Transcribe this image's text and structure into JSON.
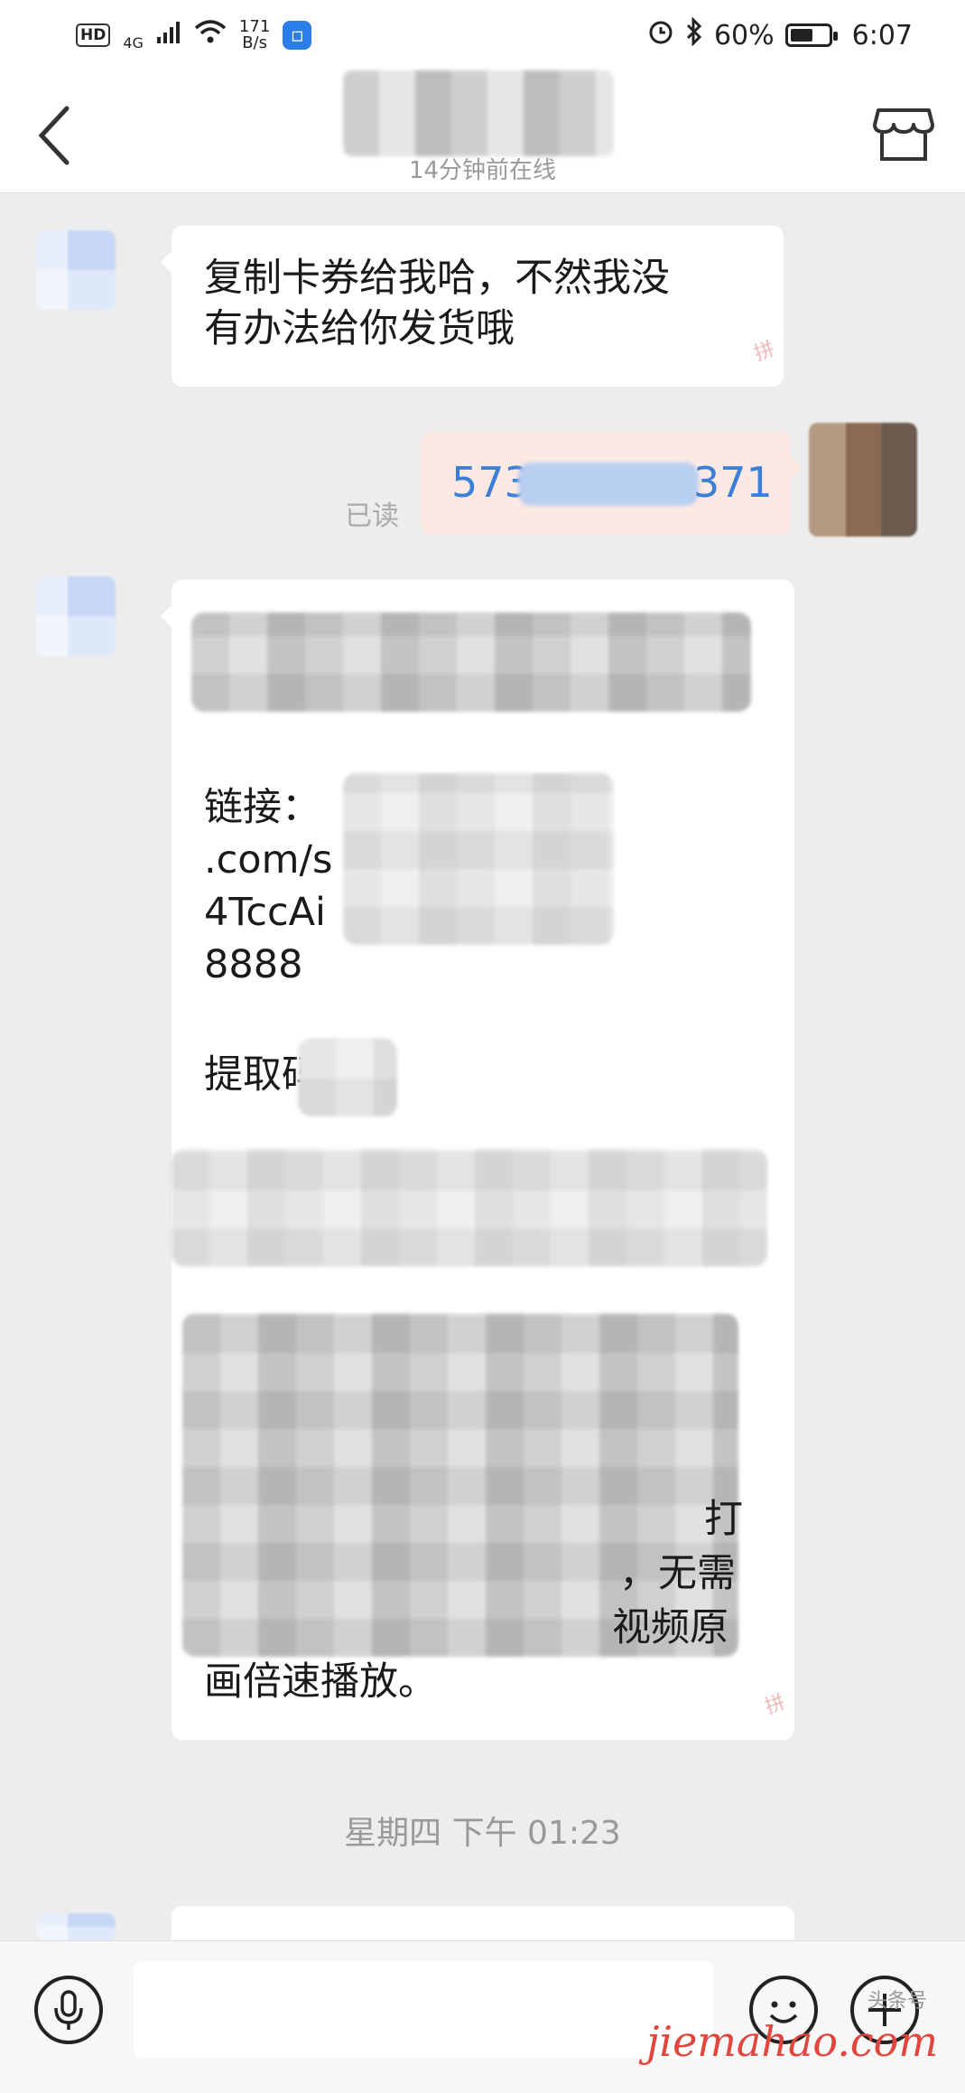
{
  "status_bar": {
    "hd": "HD",
    "network": "4G",
    "speed_value": "171",
    "speed_unit": "B/s",
    "battery_percent": "60%",
    "battery_level": 0.6,
    "time": "6:07"
  },
  "header": {
    "subtitle": "14分钟前在线"
  },
  "messages": {
    "m1_line1": "复制卡券给我哈，不然我没",
    "m1_line2": "有办法给你发货哦",
    "m2_read": "已读",
    "m2_prefix": "573",
    "m2_suffix": "371",
    "m3_link_label": "链接：",
    "m3_link_line2": ".com/s",
    "m3_link_line3": "4TccAi",
    "m3_link_line4": "8888",
    "m3_code_label": "提取码",
    "m3_frag1": "打",
    "m3_frag2": "，无需",
    "m3_frag3": "视频原",
    "m3_last": "画倍速播放。"
  },
  "timestamp": "星期四 下午 01:23",
  "watermark": "jiemahao.com",
  "watermark_small": "头条号"
}
